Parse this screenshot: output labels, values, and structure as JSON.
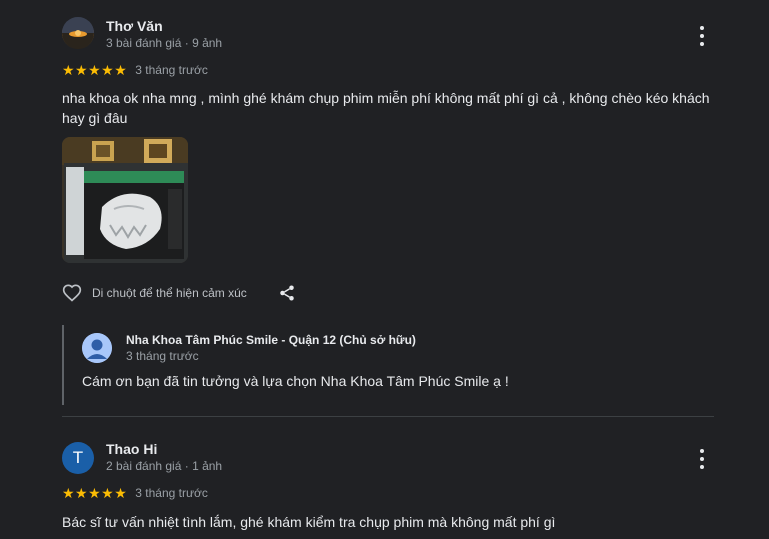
{
  "reviews": [
    {
      "author": "Thơ Văn",
      "author_meta": "3 bài đánh giá · 9 ảnh",
      "stars": "★★★★★",
      "rating": 5,
      "time": "3 tháng trước",
      "text": "nha khoa ok nha mng , mình ghé khám chụp phim miễn phí không mất phí gì cả , không chèo kéo khách hay gì đâu",
      "actions": {
        "react_label": "Di chuột để thể hiện cảm xúc"
      },
      "owner_reply": {
        "name": "Nha Khoa Tâm Phúc Smile - Quận 12 (Chủ sở hữu)",
        "time": "3 tháng trước",
        "text": "Cám ơn bạn đã tin tưởng và lựa chọn Nha Khoa Tâm Phúc Smile ạ !"
      }
    },
    {
      "author": "Thao Hi",
      "avatar_letter": "T",
      "author_meta": "2 bài đánh giá · 1 ảnh",
      "stars": "★★★★★",
      "rating": 5,
      "time": "3 tháng trước",
      "text": "Bác sĩ tư vấn nhiệt tình lắm, ghé khám kiểm tra chụp phim mà không mất phí gì"
    }
  ],
  "colors": {
    "background": "#202124",
    "star": "#fbbc04",
    "secondary_text": "#9aa0a6",
    "letter_avatar": "#1a5fa8"
  },
  "icons": [
    "more-vert-icon",
    "star-icon",
    "heart-outline-icon",
    "share-icon",
    "account-icon"
  ]
}
